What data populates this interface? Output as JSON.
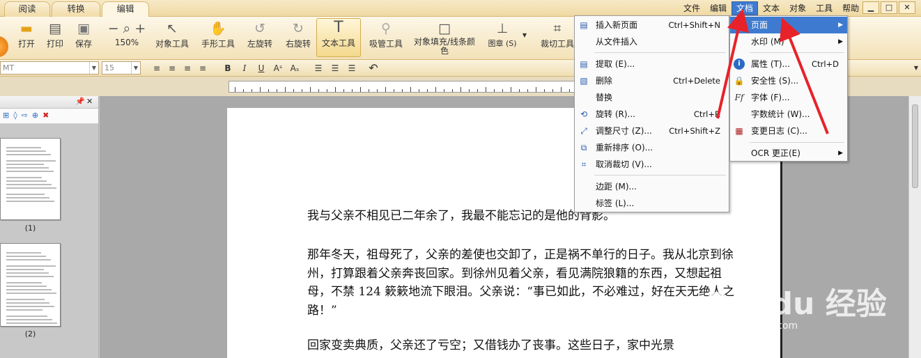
{
  "tabs": [
    {
      "label": "阅读"
    },
    {
      "label": "转换"
    },
    {
      "label": "编辑"
    }
  ],
  "menubar": [
    "文件",
    "编辑",
    "文档",
    "文本",
    "对象",
    "工具",
    "帮助"
  ],
  "window_controls": [
    "▁",
    "□",
    "✕"
  ],
  "ribbon": [
    {
      "label": "打开",
      "icon": "folder-icon"
    },
    {
      "label": "打印",
      "icon": "printer-icon"
    },
    {
      "label": "保存",
      "icon": "floppy-icon"
    },
    {
      "label": "150%",
      "icon": "zoom-icon"
    },
    {
      "label": "对象工具",
      "icon": "cursor-icon"
    },
    {
      "label": "手形工具",
      "icon": "hand-icon"
    },
    {
      "label": "左旋转",
      "icon": "rotate-left-icon"
    },
    {
      "label": "右旋转",
      "icon": "rotate-right-icon"
    },
    {
      "label": "文本工具",
      "icon": "text-tool-icon"
    },
    {
      "label": "吸管工具",
      "icon": "eyedropper-icon"
    },
    {
      "label": "对象填充/线条颜色",
      "icon": "fill-color-icon"
    },
    {
      "label": "图章 (S)",
      "icon": "stamp-icon"
    },
    {
      "label": "裁切工具",
      "icon": "crop-icon"
    }
  ],
  "format_bar": {
    "font_name": "MT",
    "font_size": "15"
  },
  "thumbnails": [
    {
      "label": "(1)"
    },
    {
      "label": "(2)"
    }
  ],
  "document": {
    "paragraphs": [
      "我与父亲不相见已二年余了，我最不能忘记的是他的背影。",
      "那年冬天，祖母死了，父亲的差使也交卸了，正是祸不单行的日子。我从北京到徐州，打算跟着父亲奔丧回家。到徐州见着父亲，看见满院狼籍的东西，又想起祖母，不禁 124 簌簌地流下眼泪。父亲说：“事已如此，不必难过，好在天无绝人之路！”",
      "回家变卖典质，父亲还了亏空；又借钱办了丧事。这些日子，家中光景"
    ]
  },
  "document_menu": {
    "items": [
      {
        "label": "插入新页面",
        "shortcut": "Ctrl+Shift+N",
        "icon": "insert-page-icon"
      },
      {
        "label": "从文件插入",
        "shortcut": "",
        "icon": ""
      },
      {
        "label": "提取 (E)...",
        "shortcut": "",
        "icon": "extract-icon"
      },
      {
        "label": "删除",
        "shortcut": "Ctrl+Delete",
        "icon": "delete-page-icon"
      },
      {
        "label": "替换",
        "shortcut": "",
        "icon": ""
      },
      {
        "label": "旋转 (R)...",
        "shortcut": "Ctrl+R",
        "icon": "rotate-page-icon"
      },
      {
        "label": "调整尺寸 (Z)...",
        "shortcut": "Ctrl+Shift+Z",
        "icon": "resize-icon"
      },
      {
        "label": "重新排序 (O)...",
        "shortcut": "",
        "icon": "reorder-icon"
      },
      {
        "label": "取消裁切 (V)...",
        "shortcut": "",
        "icon": "uncrop-icon"
      },
      {
        "label": "边距 (M)...",
        "shortcut": "",
        "icon": ""
      },
      {
        "label": "标签 (L)...",
        "shortcut": "",
        "icon": ""
      }
    ]
  },
  "page_submenu": {
    "items": [
      {
        "label": "页面",
        "shortcut": "",
        "submenu": true
      },
      {
        "label": "水印 (M)",
        "shortcut": "",
        "submenu": true
      },
      {
        "label": "属性 (T)...",
        "shortcut": "Ctrl+D",
        "icon": "info-icon"
      },
      {
        "label": "安全性 (S)...",
        "shortcut": "",
        "icon": "lock-icon"
      },
      {
        "label": "字体 (F)...",
        "shortcut": "",
        "icon": "font-icon"
      },
      {
        "label": "字数统计 (W)...",
        "shortcut": "",
        "icon": ""
      },
      {
        "label": "变更日志 (C)...",
        "shortcut": "",
        "icon": "changelog-icon"
      },
      {
        "label": "OCR 更正(E)",
        "shortcut": "",
        "submenu": true
      }
    ]
  },
  "watermark": {
    "logo": "Bai du 经验",
    "url": "jingyan.baidu.com"
  },
  "colors": {
    "accent": "#3e7bd0",
    "ribbon": "#f3e2b8",
    "arrow": "#e8222a"
  }
}
